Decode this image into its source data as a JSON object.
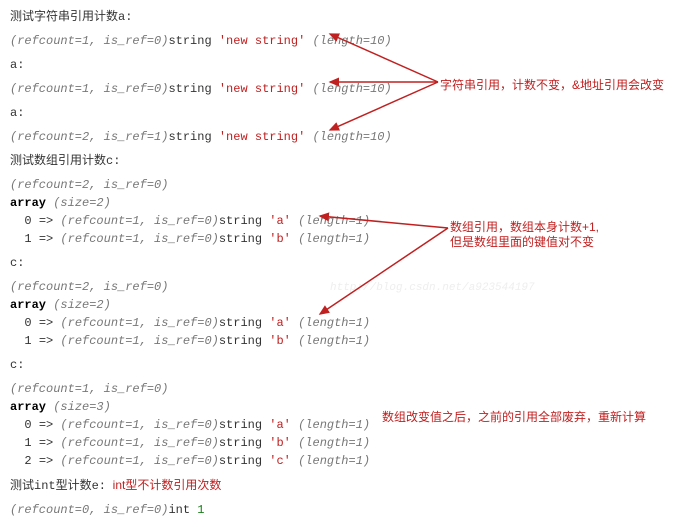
{
  "sec1": {
    "title": "测试字符串引用计数a:",
    "dump": {
      "ref": "(refcount=1, is_ref=0)",
      "type": "string ",
      "val": "'new string'",
      "len": " (length=10)"
    }
  },
  "sec2": {
    "title": "a:",
    "dump": {
      "ref": "(refcount=1, is_ref=0)",
      "type": "string ",
      "val": "'new string'",
      "len": " (length=10)"
    }
  },
  "sec3": {
    "title": "a:",
    "dump": {
      "ref": "(refcount=2, is_ref=1)",
      "type": "string ",
      "val": "'new string'",
      "len": " (length=10)"
    }
  },
  "sec4": {
    "title": "测试数组引用计数c:",
    "ref": "(refcount=2, is_ref=0)",
    "arr": "array",
    "size": " (size=2)",
    "k0": "  0 ",
    "arrow0": "=>",
    "ref0": " (refcount=1, is_ref=0)",
    "type0": "string ",
    "val0": "'a'",
    "len0": " (length=1)",
    "k1": "  1 ",
    "arrow1": "=>",
    "ref1": " (refcount=1, is_ref=0)",
    "type1": "string ",
    "val1": "'b'",
    "len1": " (length=1)"
  },
  "sec5": {
    "title": "c:",
    "ref": "(refcount=2, is_ref=0)",
    "arr": "array",
    "size": " (size=2)",
    "k0": "  0 ",
    "arrow0": "=>",
    "ref0": " (refcount=1, is_ref=0)",
    "type0": "string ",
    "val0": "'a'",
    "len0": " (length=1)",
    "k1": "  1 ",
    "arrow1": "=>",
    "ref1": " (refcount=1, is_ref=0)",
    "type1": "string ",
    "val1": "'b'",
    "len1": " (length=1)"
  },
  "sec6": {
    "title": "c:",
    "ref": "(refcount=1, is_ref=0)",
    "arr": "array",
    "size": " (size=3)",
    "k0": "  0 ",
    "arrow0": "=>",
    "ref0": " (refcount=1, is_ref=0)",
    "type0": "string ",
    "val0": "'a'",
    "len0": " (length=1)",
    "k1": "  1 ",
    "arrow1": "=>",
    "ref1": " (refcount=1, is_ref=0)",
    "type1": "string ",
    "val1": "'b'",
    "len1": " (length=1)",
    "k2": "  2 ",
    "arrow2": "=>",
    "ref2": " (refcount=1, is_ref=0)",
    "type2": "string ",
    "val2": "'c'",
    "len2": " (length=1)"
  },
  "sec7": {
    "title": "测试int型计数e:",
    "note": "  int型不计数引用次数",
    "ref": "(refcount=0, is_ref=0)",
    "type": "int ",
    "val": "1"
  },
  "annotations": {
    "a1": "字符串引用，计数不变，&地址引用会改变",
    "a2a": "数组引用，数组本身计数+1,",
    "a2b": "但是数组里面的键值对不变",
    "a3": "数组改变值之后，之前的引用全部废弃，重新计算"
  },
  "watermark": "http://blog.csdn.net/a923544197"
}
